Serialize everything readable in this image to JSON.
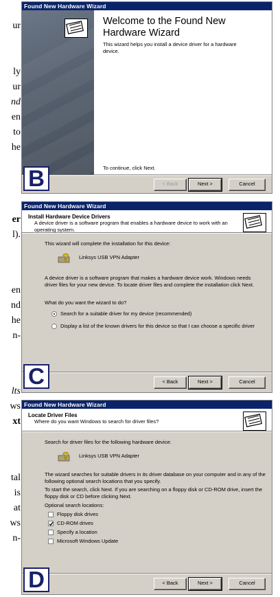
{
  "left_text": {
    "l1": "ur",
    "l2": "ly",
    "l3": "ur",
    "l4": "nd",
    "l5": "en",
    "l6": "to",
    "l7": "he",
    "l8": "er",
    "l9": "l).",
    "l10": "en",
    "l11": "nd",
    "l12": "he",
    "l13": "n-",
    "l14": "lts",
    "l15": "ws",
    "l16": "xt",
    "l17": "tal",
    "l18": "is",
    "l19": "at",
    "l20": "ws",
    "l21": "n-"
  },
  "panel_letters": {
    "b": "B",
    "c": "C",
    "d": "D"
  },
  "dialog_b": {
    "title": "Found New Hardware Wizard",
    "heading": "Welcome to the Found New Hardware Wizard",
    "description": "This wizard helps you install a device driver for a hardware device.",
    "continue_text": "To continue, click Next.",
    "back": "< Back",
    "next": "Next >",
    "cancel": "Cancel"
  },
  "dialog_c": {
    "title": "Found New Hardware Wizard",
    "header_title": "Install Hardware Device Drivers",
    "header_sub": "A device driver is a software program that enables a hardware device to work with an operating system.",
    "intro": "This wizard will complete the installation for this device:",
    "device": "Linksys USB VPN Adapter",
    "explanation": "A device driver is a software program that makes a hardware device work. Windows needs driver files for your new device. To locate driver files and complete the installation click Next.",
    "question": "What do you want the wizard to do?",
    "option1": "Search for a suitable driver for my device (recommended)",
    "option2": "Display a list of the known drivers for this device so that I can choose a specific driver",
    "back": "< Back",
    "next": "Next >",
    "cancel": "Cancel"
  },
  "dialog_d": {
    "title": "Found New Hardware Wizard",
    "header_title": "Locate Driver Files",
    "header_sub": "Where do you want Windows to search for driver files?",
    "intro": "Search for driver files for the following hardware device:",
    "device": "Linksys USB VPN Adapter",
    "explanation1": "The wizard searches for suitable drivers in its driver database on your computer and in any of the following optional search locations that you specify.",
    "explanation2": "To start the search, click Next. If you are searching on a floppy disk or CD-ROM drive, insert the floppy disk or CD before clicking Next.",
    "optional_label": "Optional search locations:",
    "opt_floppy": "Floppy disk drives",
    "opt_cdrom": "CD-ROM drives",
    "opt_location": "Specify a location",
    "opt_update": "Microsoft Windows Update",
    "back": "< Back",
    "next": "Next >",
    "cancel": "Cancel"
  }
}
